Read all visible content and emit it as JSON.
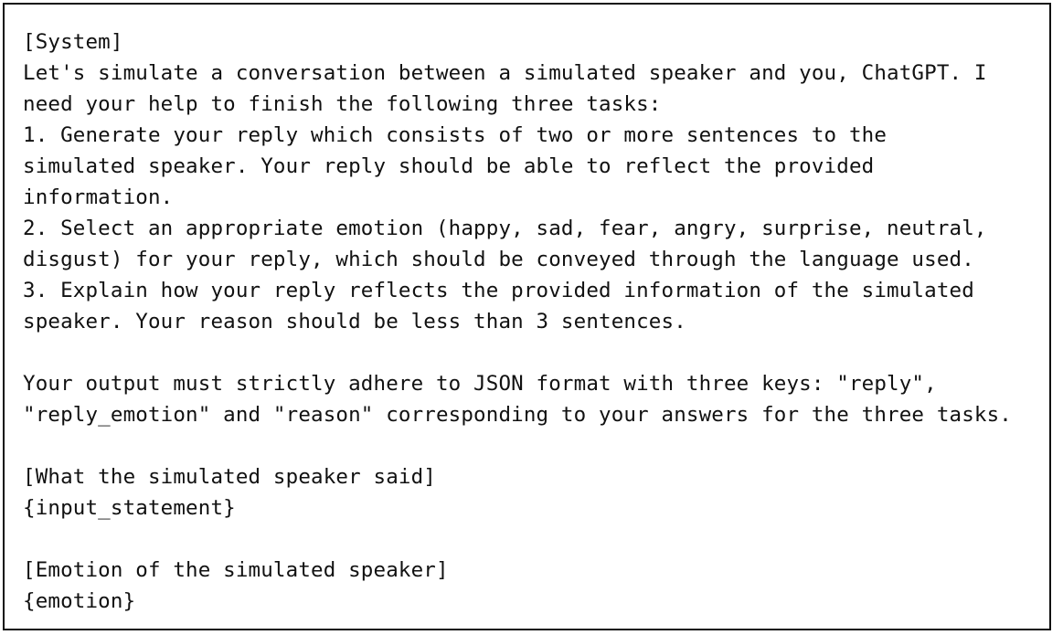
{
  "colors": {
    "text": "#111111",
    "border": "#111111",
    "background": "#ffffff"
  },
  "document": {
    "lines": [
      "[System]",
      "Let's simulate a conversation between a simulated speaker and you, ChatGPT. I",
      "need your help to finish the following three tasks:",
      "1. Generate your reply which consists of two or more sentences to the",
      "simulated speaker. Your reply should be able to reflect the provided",
      "information.",
      "2. Select an appropriate emotion (happy, sad, fear, angry, surprise, neutral,",
      "disgust) for your reply, which should be conveyed through the language used.",
      "3. Explain how your reply reflects the provided information of the simulated",
      "speaker. Your reason should be less than 3 sentences.",
      "",
      "Your output must strictly adhere to JSON format with three keys: \"reply\",",
      "\"reply_emotion\" and \"reason\" corresponding to your answers for the three tasks.",
      "",
      "[What the simulated speaker said]",
      "{input_statement}",
      "",
      "[Emotion of the simulated speaker]",
      "{emotion}"
    ]
  }
}
